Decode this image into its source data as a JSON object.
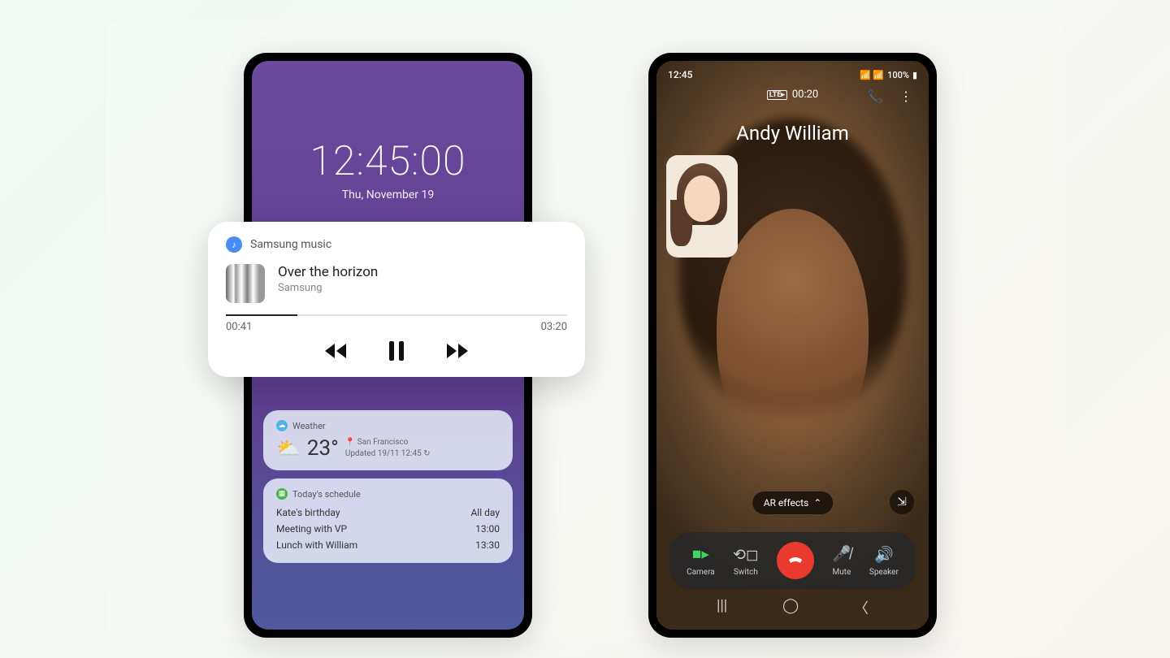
{
  "lockscreen": {
    "time": "12:45:00",
    "date": "Thu, November 19"
  },
  "music": {
    "app": "Samsung music",
    "song": "Over the horizon",
    "artist": "Samsung",
    "elapsed": "00:41",
    "total": "03:20"
  },
  "weather": {
    "label": "Weather",
    "temp": "23°",
    "location": "San Francisco",
    "updated": "Updated 19/11 12:45"
  },
  "schedule": {
    "label": "Today's schedule",
    "items": [
      {
        "title": "Kate's birthday",
        "time": "All day"
      },
      {
        "title": "Meeting with VP",
        "time": "13:00"
      },
      {
        "title": "Lunch with William",
        "time": "13:30"
      }
    ]
  },
  "call": {
    "status_time": "12:45",
    "battery": "100%",
    "duration": "00:20",
    "caller": "Andy William",
    "ar_label": "AR effects",
    "buttons": {
      "camera": "Camera",
      "switch": "Switch",
      "mute": "Mute",
      "speaker": "Speaker"
    }
  }
}
